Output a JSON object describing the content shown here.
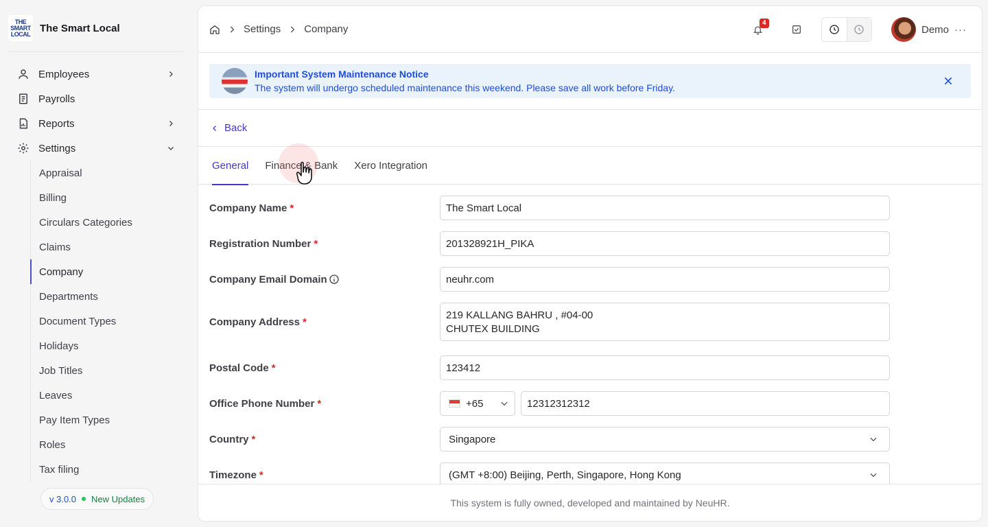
{
  "brand": {
    "name": "The Smart Local",
    "logo_lines": [
      "THE",
      "SMART",
      "LOCAL"
    ]
  },
  "nav": {
    "items": [
      {
        "label": "Employees",
        "icon": "user-icon",
        "expandable": true
      },
      {
        "label": "Payrolls",
        "icon": "receipt-icon",
        "expandable": false
      },
      {
        "label": "Reports",
        "icon": "report-icon",
        "expandable": true
      },
      {
        "label": "Settings",
        "icon": "gear-icon",
        "expanded": true
      }
    ],
    "settings_children": [
      "Appraisal",
      "Billing",
      "Circulars Categories",
      "Claims",
      "Company",
      "Departments",
      "Document Types",
      "Holidays",
      "Job Titles",
      "Leaves",
      "Pay Item Types",
      "Roles",
      "Tax filing"
    ],
    "active_child": "Company"
  },
  "version": {
    "number": "v 3.0.0",
    "update_label": "New Updates"
  },
  "breadcrumb": {
    "items": [
      "Settings",
      "Company"
    ]
  },
  "topbar": {
    "notification_count": "4",
    "user_name": "Demo",
    "more": "···"
  },
  "notice": {
    "title": "Important System Maintenance Notice",
    "body": "The system will undergo scheduled maintenance this weekend. Please save all work before Friday."
  },
  "back_label": "Back",
  "tabs": [
    {
      "label": "General",
      "active": true
    },
    {
      "label": "Finance & Bank",
      "active": false
    },
    {
      "label": "Xero Integration",
      "active": false
    }
  ],
  "form": {
    "company_name": {
      "label": "Company Name",
      "value": "The Smart Local"
    },
    "registration_number": {
      "label": "Registration Number",
      "value": "201328921H_PIKA"
    },
    "email_domain": {
      "label": "Company Email Domain",
      "value": "neuhr.com"
    },
    "address": {
      "label": "Company Address",
      "line1": "219 KALLANG BAHRU , #04-00",
      "line2": "CHUTEX BUILDING"
    },
    "postal_code": {
      "label": "Postal Code",
      "value": "123412"
    },
    "office_phone": {
      "label": "Office Phone Number",
      "country_code": "+65",
      "value": "12312312312"
    },
    "country": {
      "label": "Country",
      "value": "Singapore"
    },
    "timezone": {
      "label": "Timezone",
      "value": "(GMT +8:00) Beijing, Perth, Singapore, Hong Kong"
    },
    "required_mark": "*"
  },
  "footer": "This system is fully owned, developed and maintained by NeuHR.",
  "colors": {
    "accent": "#4338ca",
    "notice_bg": "#eaf2fb",
    "required": "#dc2626",
    "badge": "#dc2626"
  }
}
